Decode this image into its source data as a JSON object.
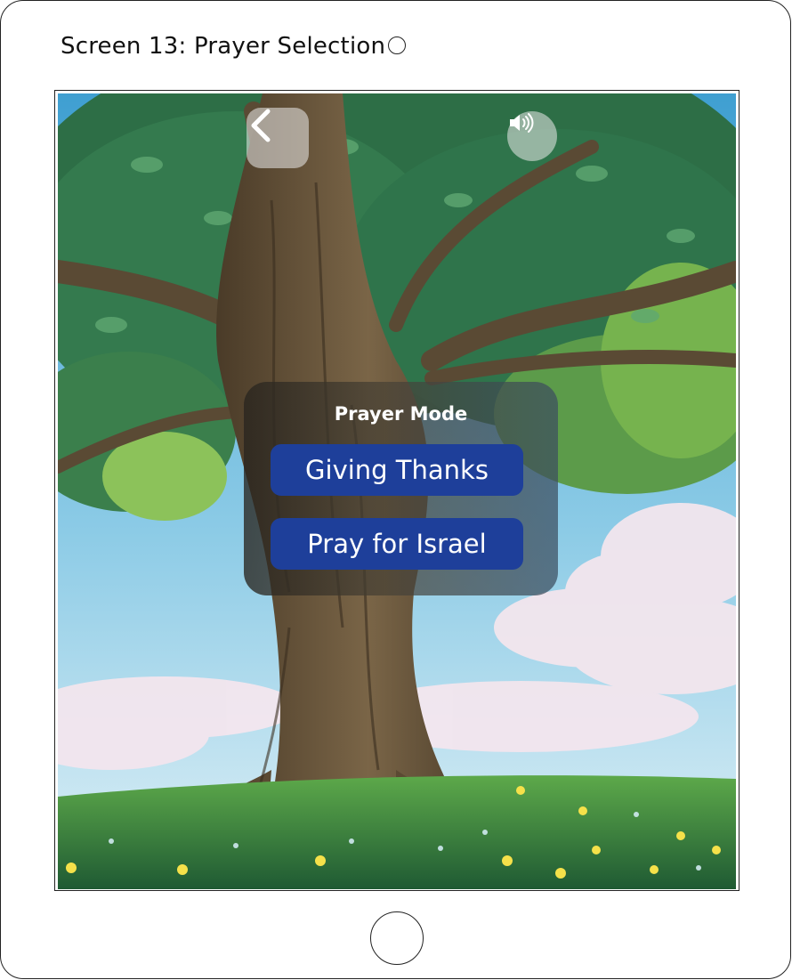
{
  "page": {
    "title": "Screen 13: Prayer Selection"
  },
  "toolbar": {
    "back_icon": "chevron-left-icon",
    "sound_icon": "speaker-volume-icon"
  },
  "modal": {
    "title": "Prayer Mode",
    "options": [
      {
        "label": "Giving Thanks"
      },
      {
        "label": "Pray for Israel"
      }
    ]
  },
  "colors": {
    "button_blue": "#1e3f9a",
    "sky": "#6fb7dd",
    "grass": "#2f7a3a",
    "foliage": "#2e7d4f"
  }
}
